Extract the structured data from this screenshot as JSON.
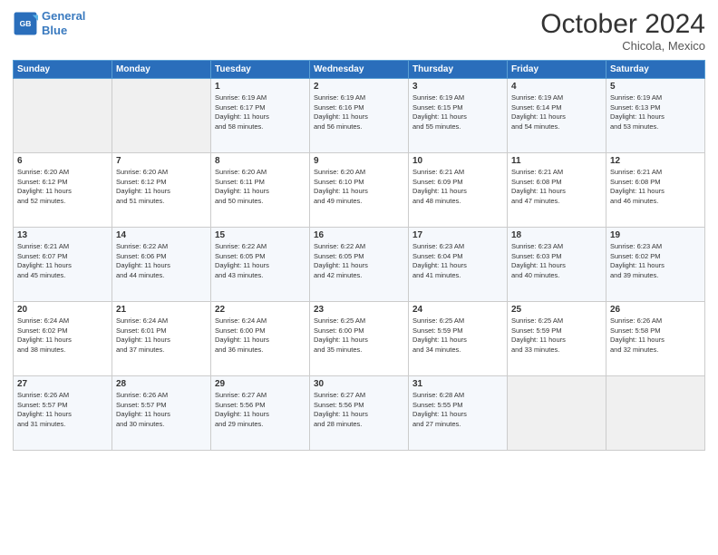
{
  "logo": {
    "line1": "General",
    "line2": "Blue"
  },
  "header": {
    "title": "October 2024",
    "subtitle": "Chicola, Mexico"
  },
  "days": [
    "Sunday",
    "Monday",
    "Tuesday",
    "Wednesday",
    "Thursday",
    "Friday",
    "Saturday"
  ],
  "weeks": [
    [
      {
        "day": "",
        "info": ""
      },
      {
        "day": "",
        "info": ""
      },
      {
        "day": "1",
        "info": "Sunrise: 6:19 AM\nSunset: 6:17 PM\nDaylight: 11 hours\nand 58 minutes."
      },
      {
        "day": "2",
        "info": "Sunrise: 6:19 AM\nSunset: 6:16 PM\nDaylight: 11 hours\nand 56 minutes."
      },
      {
        "day": "3",
        "info": "Sunrise: 6:19 AM\nSunset: 6:15 PM\nDaylight: 11 hours\nand 55 minutes."
      },
      {
        "day": "4",
        "info": "Sunrise: 6:19 AM\nSunset: 6:14 PM\nDaylight: 11 hours\nand 54 minutes."
      },
      {
        "day": "5",
        "info": "Sunrise: 6:19 AM\nSunset: 6:13 PM\nDaylight: 11 hours\nand 53 minutes."
      }
    ],
    [
      {
        "day": "6",
        "info": "Sunrise: 6:20 AM\nSunset: 6:12 PM\nDaylight: 11 hours\nand 52 minutes."
      },
      {
        "day": "7",
        "info": "Sunrise: 6:20 AM\nSunset: 6:12 PM\nDaylight: 11 hours\nand 51 minutes."
      },
      {
        "day": "8",
        "info": "Sunrise: 6:20 AM\nSunset: 6:11 PM\nDaylight: 11 hours\nand 50 minutes."
      },
      {
        "day": "9",
        "info": "Sunrise: 6:20 AM\nSunset: 6:10 PM\nDaylight: 11 hours\nand 49 minutes."
      },
      {
        "day": "10",
        "info": "Sunrise: 6:21 AM\nSunset: 6:09 PM\nDaylight: 11 hours\nand 48 minutes."
      },
      {
        "day": "11",
        "info": "Sunrise: 6:21 AM\nSunset: 6:08 PM\nDaylight: 11 hours\nand 47 minutes."
      },
      {
        "day": "12",
        "info": "Sunrise: 6:21 AM\nSunset: 6:08 PM\nDaylight: 11 hours\nand 46 minutes."
      }
    ],
    [
      {
        "day": "13",
        "info": "Sunrise: 6:21 AM\nSunset: 6:07 PM\nDaylight: 11 hours\nand 45 minutes."
      },
      {
        "day": "14",
        "info": "Sunrise: 6:22 AM\nSunset: 6:06 PM\nDaylight: 11 hours\nand 44 minutes."
      },
      {
        "day": "15",
        "info": "Sunrise: 6:22 AM\nSunset: 6:05 PM\nDaylight: 11 hours\nand 43 minutes."
      },
      {
        "day": "16",
        "info": "Sunrise: 6:22 AM\nSunset: 6:05 PM\nDaylight: 11 hours\nand 42 minutes."
      },
      {
        "day": "17",
        "info": "Sunrise: 6:23 AM\nSunset: 6:04 PM\nDaylight: 11 hours\nand 41 minutes."
      },
      {
        "day": "18",
        "info": "Sunrise: 6:23 AM\nSunset: 6:03 PM\nDaylight: 11 hours\nand 40 minutes."
      },
      {
        "day": "19",
        "info": "Sunrise: 6:23 AM\nSunset: 6:02 PM\nDaylight: 11 hours\nand 39 minutes."
      }
    ],
    [
      {
        "day": "20",
        "info": "Sunrise: 6:24 AM\nSunset: 6:02 PM\nDaylight: 11 hours\nand 38 minutes."
      },
      {
        "day": "21",
        "info": "Sunrise: 6:24 AM\nSunset: 6:01 PM\nDaylight: 11 hours\nand 37 minutes."
      },
      {
        "day": "22",
        "info": "Sunrise: 6:24 AM\nSunset: 6:00 PM\nDaylight: 11 hours\nand 36 minutes."
      },
      {
        "day": "23",
        "info": "Sunrise: 6:25 AM\nSunset: 6:00 PM\nDaylight: 11 hours\nand 35 minutes."
      },
      {
        "day": "24",
        "info": "Sunrise: 6:25 AM\nSunset: 5:59 PM\nDaylight: 11 hours\nand 34 minutes."
      },
      {
        "day": "25",
        "info": "Sunrise: 6:25 AM\nSunset: 5:59 PM\nDaylight: 11 hours\nand 33 minutes."
      },
      {
        "day": "26",
        "info": "Sunrise: 6:26 AM\nSunset: 5:58 PM\nDaylight: 11 hours\nand 32 minutes."
      }
    ],
    [
      {
        "day": "27",
        "info": "Sunrise: 6:26 AM\nSunset: 5:57 PM\nDaylight: 11 hours\nand 31 minutes."
      },
      {
        "day": "28",
        "info": "Sunrise: 6:26 AM\nSunset: 5:57 PM\nDaylight: 11 hours\nand 30 minutes."
      },
      {
        "day": "29",
        "info": "Sunrise: 6:27 AM\nSunset: 5:56 PM\nDaylight: 11 hours\nand 29 minutes."
      },
      {
        "day": "30",
        "info": "Sunrise: 6:27 AM\nSunset: 5:56 PM\nDaylight: 11 hours\nand 28 minutes."
      },
      {
        "day": "31",
        "info": "Sunrise: 6:28 AM\nSunset: 5:55 PM\nDaylight: 11 hours\nand 27 minutes."
      },
      {
        "day": "",
        "info": ""
      },
      {
        "day": "",
        "info": ""
      }
    ]
  ]
}
